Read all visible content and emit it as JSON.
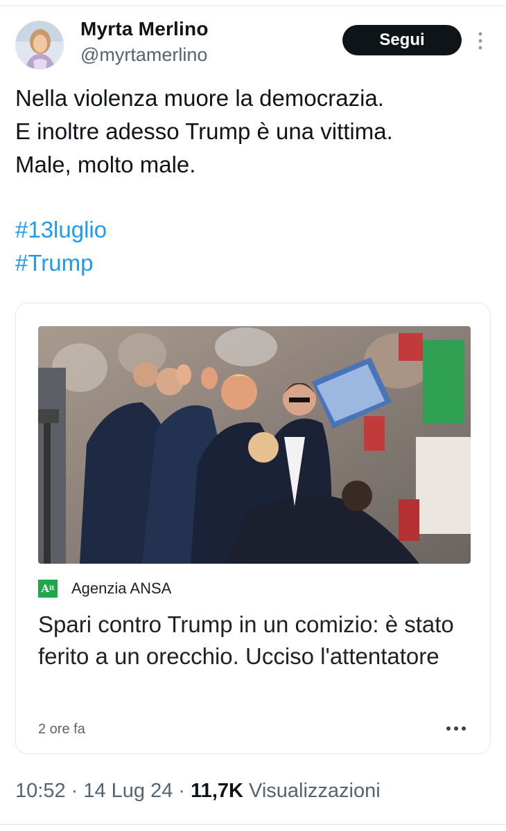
{
  "author": {
    "name": "Myrta Merlino",
    "handle": "@myrtamerlino",
    "follow_label": "Segui"
  },
  "tweet": {
    "lines": [
      "Nella violenza muore la democrazia.",
      "E inoltre adesso Trump è una vittima.",
      "Male, molto male."
    ],
    "hashtags": [
      "#13luglio",
      "#Trump"
    ]
  },
  "card": {
    "source_logo_text": "A",
    "source_logo_sup": "it",
    "source_name": "Agenzia ANSA",
    "headline": "Spari contro Trump in un comizio: è stato ferito a un orecchio. Ucciso l'attentatore",
    "time": "2 ore fa"
  },
  "meta": {
    "time": "10:52",
    "sep1": " · ",
    "date": "14 Lug 24",
    "sep2": " · ",
    "views_count": "11,7K",
    "views_label": " Visualizzazioni"
  },
  "icons": {
    "more": "more-vertical-icon",
    "card_more": "more-horizontal-icon"
  },
  "colors": {
    "link": "#1d9bf0",
    "text": "#0f1419",
    "secondary": "#536471",
    "source_logo": "#1ea84a"
  }
}
